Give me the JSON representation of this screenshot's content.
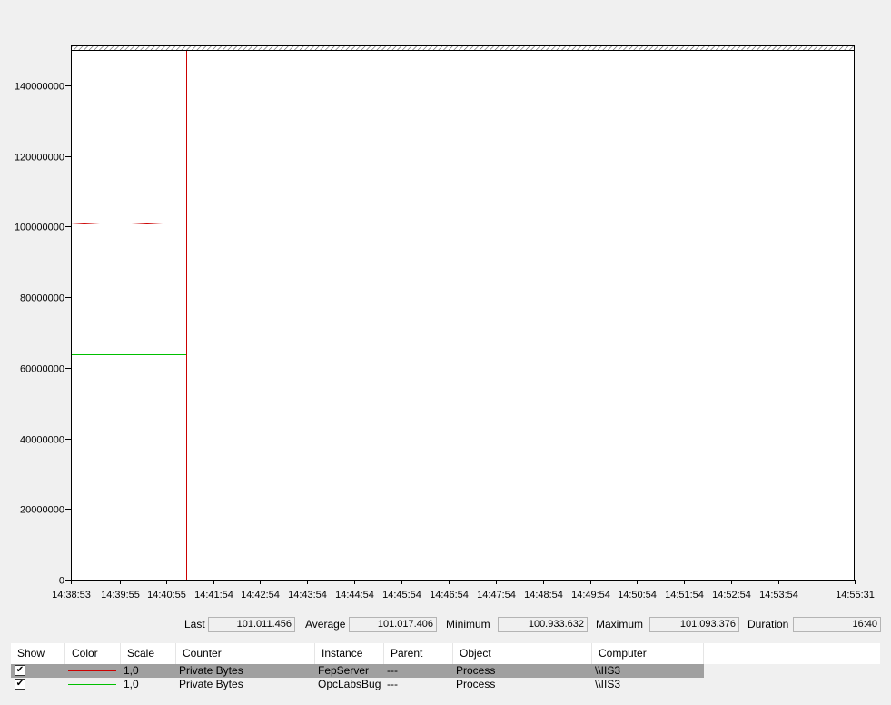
{
  "chart_data": {
    "type": "line",
    "x": [
      "14:38:53",
      "14:39:10",
      "14:39:30",
      "14:39:50",
      "14:40:10",
      "14:40:30",
      "14:40:50",
      "14:41:10",
      "14:41:20"
    ],
    "series": [
      {
        "color": "#cc0000",
        "values": [
          100990000,
          100970000,
          101020000,
          101093376,
          101000000,
          100933632,
          101030000,
          101060000,
          101011456
        ]
      },
      {
        "color": "#00c000",
        "values": [
          63800000,
          63800000,
          63800000,
          63800000,
          63800000,
          63800000,
          63800000,
          63800000,
          63800000
        ]
      }
    ],
    "xlim": [
      "14:38:53",
      "14:55:31"
    ],
    "x_ticks": [
      "14:38:53",
      "14:39:55",
      "14:40:55",
      "14:41:54",
      "14:42:54",
      "14:43:54",
      "14:44:54",
      "14:45:54",
      "14:46:54",
      "14:47:54",
      "14:48:54",
      "14:49:54",
      "14:50:54",
      "14:51:54",
      "14:52:54",
      "14:53:54",
      "14:55:31"
    ],
    "ylim": [
      0,
      150000000
    ],
    "y_ticks": [
      0,
      20000000,
      40000000,
      60000000,
      80000000,
      100000000,
      120000000,
      140000000
    ],
    "grid": false,
    "cursor_color": "#cc0000"
  },
  "stats": {
    "last_label": "Last",
    "last_value": "101.011.456",
    "average_label": "Average",
    "average_value": "101.017.406",
    "minimum_label": "Minimum",
    "minimum_value": "100.933.632",
    "maximum_label": "Maximum",
    "maximum_value": "101.093.376",
    "duration_label": "Duration",
    "duration_value": "16:40"
  },
  "counter_list": {
    "columns": {
      "show": "Show",
      "color": "Color",
      "scale": "Scale",
      "counter": "Counter",
      "instance": "Instance",
      "parent": "Parent",
      "object": "Object",
      "computer": "Computer"
    },
    "rows": [
      {
        "checked": true,
        "selected": true,
        "color": "#cc0000",
        "scale": "1,0",
        "counter": "Private Bytes",
        "instance": "FepServer",
        "parent": "---",
        "object": "Process",
        "computer": "\\\\IIS3"
      },
      {
        "checked": true,
        "selected": false,
        "color": "#00c000",
        "scale": "1,0",
        "counter": "Private Bytes",
        "instance": "OpcLabsBug",
        "parent": "---",
        "object": "Process",
        "computer": "\\\\IIS3"
      }
    ]
  },
  "colors": {
    "selected_row": "#a0a0a0"
  }
}
